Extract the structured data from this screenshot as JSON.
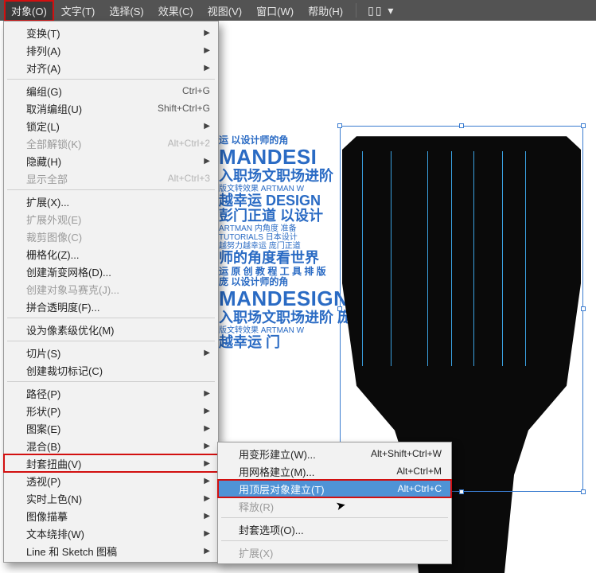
{
  "menubar": {
    "items": [
      "对象(O)",
      "文字(T)",
      "选择(S)",
      "效果(C)",
      "视图(V)",
      "窗口(W)",
      "帮助(H)"
    ],
    "active_index": 0,
    "tool_glyph": "▯▯ ▾"
  },
  "dropdown": [
    {
      "type": "item",
      "label": "变换(T)",
      "sub": true
    },
    {
      "type": "item",
      "label": "排列(A)",
      "sub": true
    },
    {
      "type": "item",
      "label": "对齐(A)",
      "sub": true
    },
    {
      "type": "hr"
    },
    {
      "type": "item",
      "label": "编组(G)",
      "hk": "Ctrl+G"
    },
    {
      "type": "item",
      "label": "取消编组(U)",
      "hk": "Shift+Ctrl+G"
    },
    {
      "type": "item",
      "label": "锁定(L)",
      "sub": true
    },
    {
      "type": "item",
      "label": "全部解锁(K)",
      "hk": "Alt+Ctrl+2",
      "disabled": true
    },
    {
      "type": "item",
      "label": "隐藏(H)",
      "sub": true
    },
    {
      "type": "item",
      "label": "显示全部",
      "hk": "Alt+Ctrl+3",
      "disabled": true
    },
    {
      "type": "hr"
    },
    {
      "type": "item",
      "label": "扩展(X)..."
    },
    {
      "type": "item",
      "label": "扩展外观(E)",
      "disabled": true
    },
    {
      "type": "item",
      "label": "裁剪图像(C)",
      "disabled": true
    },
    {
      "type": "item",
      "label": "栅格化(Z)..."
    },
    {
      "type": "item",
      "label": "创建渐变网格(D)..."
    },
    {
      "type": "item",
      "label": "创建对象马赛克(J)...",
      "disabled": true
    },
    {
      "type": "item",
      "label": "拼合透明度(F)..."
    },
    {
      "type": "hr"
    },
    {
      "type": "item",
      "label": "设为像素级优化(M)"
    },
    {
      "type": "hr"
    },
    {
      "type": "item",
      "label": "切片(S)",
      "sub": true
    },
    {
      "type": "item",
      "label": "创建裁切标记(C)"
    },
    {
      "type": "hr"
    },
    {
      "type": "item",
      "label": "路径(P)",
      "sub": true
    },
    {
      "type": "item",
      "label": "形状(P)",
      "sub": true
    },
    {
      "type": "item",
      "label": "图案(E)",
      "sub": true
    },
    {
      "type": "item",
      "label": "混合(B)",
      "sub": true
    },
    {
      "type": "item",
      "label": "封套扭曲(V)",
      "sub": true,
      "hl": true
    },
    {
      "type": "item",
      "label": "透视(P)",
      "sub": true
    },
    {
      "type": "item",
      "label": "实时上色(N)",
      "sub": true
    },
    {
      "type": "item",
      "label": "图像描摹",
      "sub": true
    },
    {
      "type": "item",
      "label": "文本绕排(W)",
      "sub": true
    },
    {
      "type": "item",
      "label": "Line 和 Sketch 图稿",
      "sub": true
    }
  ],
  "submenu": [
    {
      "type": "item",
      "label": "用变形建立(W)...",
      "hk": "Alt+Shift+Ctrl+W"
    },
    {
      "type": "item",
      "label": "用网格建立(M)...",
      "hk": "Alt+Ctrl+M"
    },
    {
      "type": "item",
      "label": "用顶层对象建立(T)",
      "hk": "Alt+Ctrl+C",
      "sel": true
    },
    {
      "type": "item",
      "label": "释放(R)",
      "disabled": true
    },
    {
      "type": "hr"
    },
    {
      "type": "item",
      "label": "封套选项(O)..."
    },
    {
      "type": "hr"
    },
    {
      "type": "item",
      "label": "扩展(X)",
      "disabled": true
    }
  ],
  "canvas_text": {
    "l1": "运 以设计师的角",
    "l2": "MANDESI",
    "l3": "入职场文职场进阶",
    "l4": "版文转效果 ARTMAN  W",
    "l5": "越幸运  DESIGN",
    "l6": "彭门正道  以设计",
    "l7": "ARTMAN  内角度 准备",
    "l8": "TUTORIALS 日本设计",
    "l9": "越努力越幸运 庞门正道",
    "l10": "师的角度看世界",
    "l11": "运 原 创 教 程 工 具 排 版",
    "l12": "庞 以设计师的角",
    "l13": "MANDESIGN",
    "l14": "入职场文职场进阶 庞",
    "l15": "版文转效果 ARTMAN W",
    "l16": "越幸运  门",
    "guide_xs": [
      180,
      216,
      262,
      292,
      320,
      356,
      385
    ]
  }
}
